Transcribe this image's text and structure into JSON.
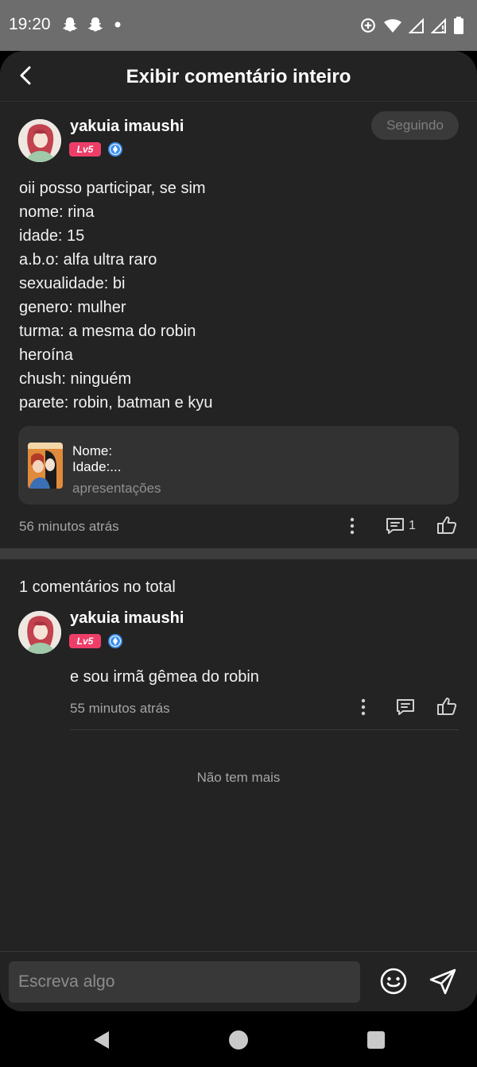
{
  "status_bar": {
    "time": "19:20",
    "left_icons": [
      "snapchat-icon",
      "snapchat-icon",
      "dot-icon"
    ],
    "right_icons": [
      "data-saver-icon",
      "wifi-icon",
      "signal-icon",
      "signal-icon",
      "battery-icon"
    ]
  },
  "header": {
    "title": "Exibir comentário inteiro"
  },
  "post": {
    "author": {
      "name": "yakuia imaushi",
      "level": "Lv5"
    },
    "follow_label": "Seguindo",
    "lines": [
      "oii posso participar, se sim",
      "nome: rina",
      "idade: 15",
      "a.b.o: alfa ultra raro",
      "sexualidade: bi",
      "genero: mulher",
      "turma: a mesma do robin",
      "heroína",
      "chush: ninguém",
      "parete: robin, batman e kyu"
    ],
    "reference": {
      "name_line": "Nome:",
      "age_line": "Idade:...",
      "category": "apresentações"
    },
    "time": "56 minutos atrás",
    "comment_count": "1"
  },
  "comments": {
    "total_label": "1 comentários no total",
    "items": [
      {
        "name": "yakuia imaushi",
        "level": "Lv5",
        "text": "e sou irmã gêmea do robin",
        "time": "55 minutos atrás"
      }
    ],
    "end_label": "Não tem mais"
  },
  "input": {
    "placeholder": "Escreva algo"
  },
  "colors": {
    "background": "#232323",
    "level_badge": "#ee3e68",
    "verified": "#3b8ef0"
  }
}
